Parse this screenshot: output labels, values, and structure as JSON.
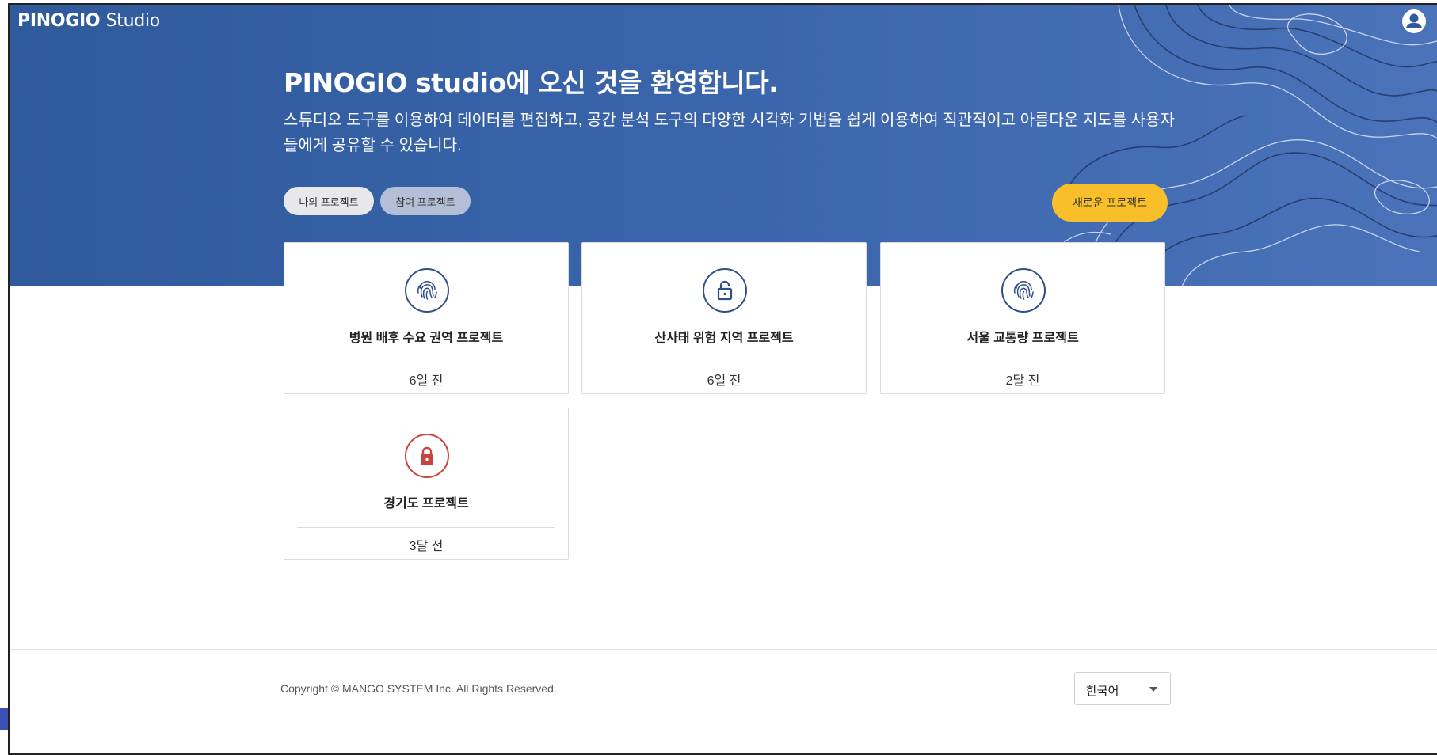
{
  "header": {
    "logo_bold": "PINOGIO",
    "logo_light": "Studio"
  },
  "hero": {
    "title": "PINOGIO studio에 오신 것을 환영합니다.",
    "description": "스튜디오 도구를 이용하여 데이터를 편집하고, 공간 분석 도구의 다양한 시각화 기법을 쉽게 이용하여 직관적이고 아름다운 지도를 사용자들에게 공유할 수 있습니다."
  },
  "tabs": {
    "mine": "나의 프로젝트",
    "joined": "참여 프로젝트"
  },
  "new_project_label": "새로운 프로젝트",
  "projects": [
    {
      "name": "병원 배후 수요 권역 프로젝트",
      "time": "6일 전",
      "icon": "fingerprint-icon"
    },
    {
      "name": "산사태 위험 지역 프로젝트",
      "time": "6일 전",
      "icon": "unlock-icon"
    },
    {
      "name": "서울 교통량 프로젝트",
      "time": "2달 전",
      "icon": "fingerprint-icon"
    },
    {
      "name": "경기도 프로젝트",
      "time": "3달 전",
      "icon": "lock-icon"
    }
  ],
  "footer": {
    "copyright": "Copyright © MANGO SYSTEM Inc. All Rights Reserved.",
    "language": "한국어"
  },
  "colors": {
    "hero_blue": "#3a64aa",
    "accent_yellow": "#f8bf2a",
    "icon_navy": "#2f4f86",
    "icon_red": "#c8453f"
  }
}
